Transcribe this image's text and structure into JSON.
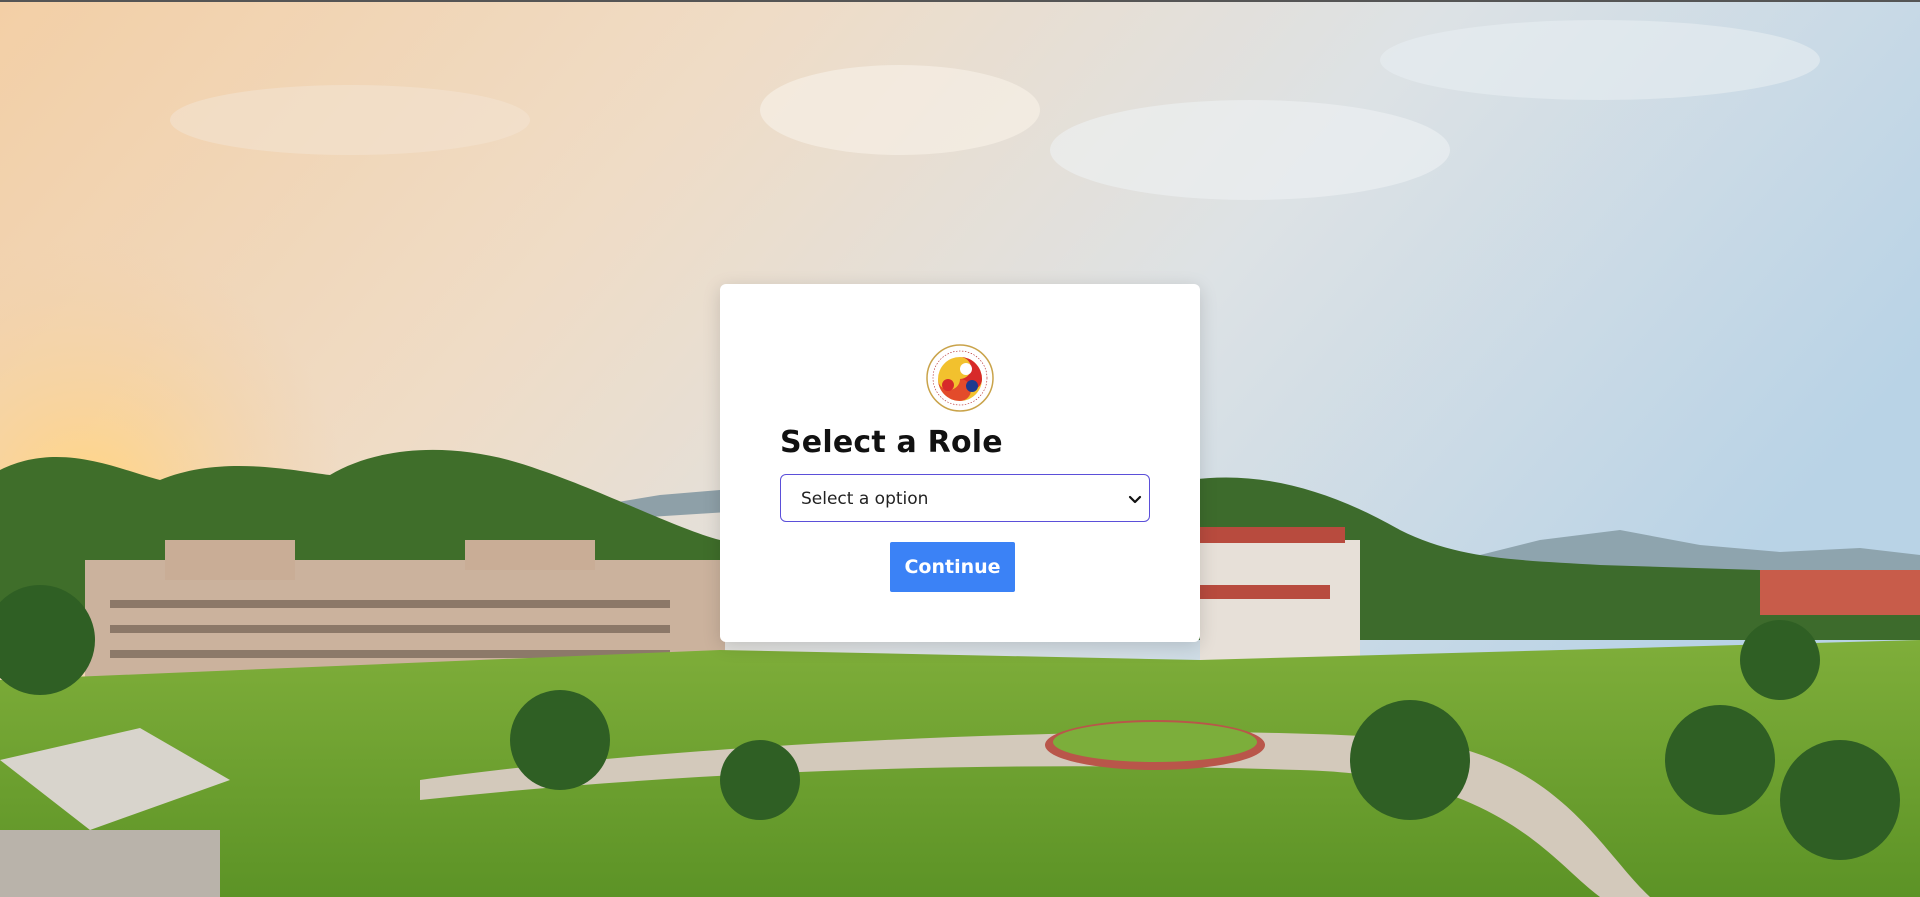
{
  "background": {
    "description_icon": "campus-landscape-image"
  },
  "card": {
    "logo_icon": "institute-emblem-icon",
    "title": "Select a Role",
    "select": {
      "selected_value": "Select a option"
    },
    "continue_label": "Continue"
  },
  "colors": {
    "button": "#3b82f6",
    "select_border": "#5b4fd9",
    "card": "#ffffff"
  }
}
